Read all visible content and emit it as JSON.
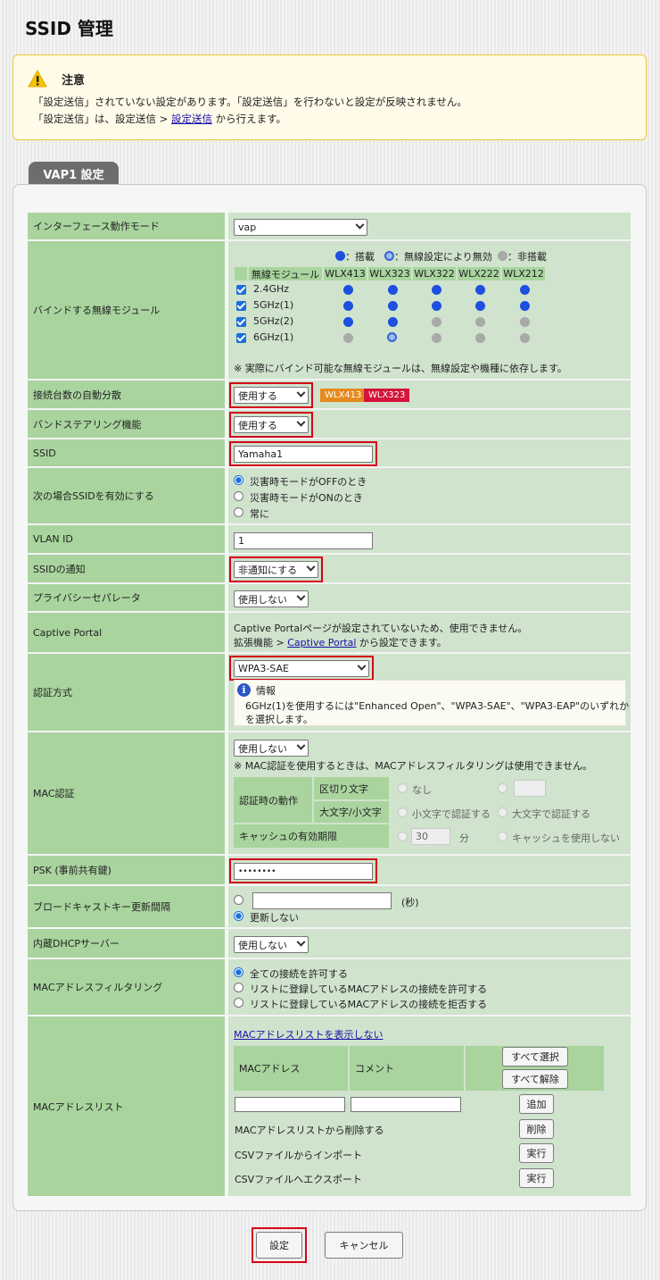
{
  "title": "SSID 管理",
  "notice": {
    "heading": "注意",
    "line1": "「設定送信」されていない設定があります。「設定送信」を行わないと設定が反映されません。",
    "line2_prefix": "「設定送信」は、設定送信 > ",
    "line2_link": "設定送信",
    "line2_suffix": " から行えます。"
  },
  "tab": "VAP1 設定",
  "rows": {
    "interface_mode": {
      "label": "インターフェース動作モード",
      "value": "vap"
    },
    "bind": {
      "label": "バインドする無線モジュール",
      "legend": {
        "installed": "：搭載",
        "disabled": "：無線設定により無効",
        "absent": "：非搭載"
      },
      "header": [
        "無線モジュール",
        "WLX413",
        "WLX323",
        "WLX322",
        "WLX222",
        "WLX212"
      ],
      "bands": [
        "2.4GHz",
        "5GHz(1)",
        "5GHz(2)",
        "6GHz(1)"
      ],
      "note": "※ 実際にバインド可能な無線モジュールは、無線設定や機種に依存します。"
    },
    "auto_distribution": {
      "label": "接続台数の自動分散",
      "value": "使用する",
      "badges": [
        "WLX413",
        "WLX323"
      ],
      "badge_colors": [
        "#e58a1e",
        "#d4143a"
      ]
    },
    "band_steering": {
      "label": "バンドステアリング機能",
      "value": "使用する"
    },
    "ssid": {
      "label": "SSID",
      "value": "Yamaha1"
    },
    "ssid_enable": {
      "label": "次の場合SSIDを有効にする",
      "options": [
        "災害時モードがOFFのとき",
        "災害時モードがONのとき",
        "常に"
      ]
    },
    "vlan": {
      "label": "VLAN ID",
      "value": "1"
    },
    "ssid_notify": {
      "label": "SSIDの通知",
      "value": "非通知にする"
    },
    "privacy": {
      "label": "プライバシーセパレータ",
      "value": "使用しない"
    },
    "captive": {
      "label": "Captive Portal",
      "line1": "Captive Portalページが設定されていないため、使用できません。",
      "line2_prefix": "拡張機能 > ",
      "line2_link": "Captive Portal",
      "line2_suffix": " から設定できます。"
    },
    "auth": {
      "label": "認証方式",
      "value": "WPA3-SAE",
      "info_title": "情報",
      "info_line1": "6GHz(1)を使用するには\"Enhanced Open\"、\"WPA3-SAE\"、\"WPA3-EAP\"のいずれか",
      "info_line2": "を選択します。"
    },
    "mac_auth": {
      "label": "MAC認証",
      "value": "使用しない",
      "note": "※ MAC認証を使用するときは、MACアドレスフィルタリングは使用できません。",
      "op_label": "認証時の動作",
      "delim_label": "区切り文字",
      "delim_none": "なし",
      "case_label": "大文字/小文字",
      "case_lower": "小文字で認証する",
      "case_upper": "大文字で認証する",
      "cache_label": "キャッシュの有効期限",
      "cache_value": "30",
      "cache_unit": "分",
      "cache_none": "キャッシュを使用しない"
    },
    "psk": {
      "label": "PSK (事前共有鍵)",
      "value": "••••••••"
    },
    "broadcast": {
      "label": "ブロードキャストキー更新間隔",
      "unit": "(秒)",
      "no_update": "更新しない"
    },
    "dhcp": {
      "label": "内蔵DHCPサーバー",
      "value": "使用しない"
    },
    "mac_filter": {
      "label": "MACアドレスフィルタリング",
      "options": [
        "全ての接続を許可する",
        "リストに登録しているMACアドレスの接続を許可する",
        "リストに登録しているMACアドレスの接続を拒否する"
      ]
    },
    "mac_list": {
      "label": "MACアドレスリスト",
      "toggle_link": "MACアドレスリストを表示しない",
      "col_mac": "MACアドレス",
      "col_comment": "コメント",
      "select_all": "すべて選択",
      "deselect_all": "すべて解除",
      "add": "追加",
      "delete_label": "MACアドレスリストから削除する",
      "delete_btn": "削除",
      "import_label": "CSVファイルからインポート",
      "import_btn": "実行",
      "export_label": "CSVファイルへエクスポート",
      "export_btn": "実行"
    }
  },
  "buttons": {
    "submit": "設定",
    "cancel": "キャンセル"
  }
}
